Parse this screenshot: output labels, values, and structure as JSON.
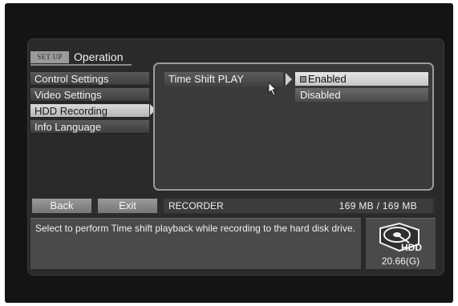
{
  "header": {
    "setup_tag": "SET UP",
    "title": "Operation"
  },
  "sidebar": {
    "items": [
      {
        "label": "Control Settings"
      },
      {
        "label": "Video Settings"
      },
      {
        "label": "HDD Recording",
        "active": true
      },
      {
        "label": "Info Language"
      }
    ]
  },
  "panel": {
    "option_label": "Time Shift PLAY",
    "choices": [
      {
        "label": "Enabled",
        "selected": true
      },
      {
        "label": "Disabled",
        "selected": false
      }
    ]
  },
  "bottom_bar": {
    "back_label": "Back",
    "exit_label": "Exit",
    "mode_label": "RECORDER",
    "size_text": "169 MB /  169 MB"
  },
  "info": {
    "description": "Select to perform Time shift playback while recording to the hard disk drive."
  },
  "hdd": {
    "icon": "hdd-disk-icon",
    "label": "HDD",
    "capacity": "20.66(G)"
  },
  "colors": {
    "background": "#141414",
    "panel_border": "#9a9a9a",
    "highlight": "#d9d9d9"
  }
}
